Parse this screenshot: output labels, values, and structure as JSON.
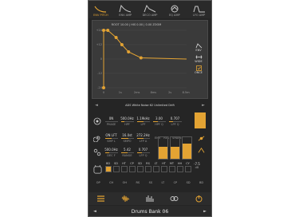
{
  "theme": {
    "accent": "#e3a333",
    "panel": "#3a3a3a",
    "bg": "#252525"
  },
  "tabs": [
    {
      "label": "ENV PITCH",
      "icon": "pitch-curve-icon",
      "active": true
    },
    {
      "label": "ENV AMP",
      "icon": "amp-curve-icon",
      "active": false
    },
    {
      "label": "DECO AMP",
      "icon": "deco-curve-icon",
      "active": false
    },
    {
      "label": "EQ AMP",
      "icon": "eq-curve-icon",
      "active": false
    },
    {
      "label": "LFO AMP",
      "icon": "lfo-curve-icon",
      "active": false
    }
  ],
  "envelope": {
    "title": "ROOT 10.00 | HIS 0.00 | 0.00 ZOOM",
    "y_ticks": [
      "+24",
      "+12",
      "0",
      "-12",
      "-24"
    ],
    "x_ticks": [
      "0",
      "1s",
      "2ms",
      "8ms",
      "2s",
      "8.5ms"
    ],
    "points": [
      {
        "t": 0.0,
        "v": 24
      },
      {
        "t": 0.5,
        "v": 24
      },
      {
        "t": 1.5,
        "v": 18
      },
      {
        "t": 2.2,
        "v": 12
      },
      {
        "t": 3.0,
        "v": 6
      },
      {
        "t": 4.5,
        "v": 1
      },
      {
        "t": 10.0,
        "v": 0
      }
    ],
    "side_buttons": [
      {
        "label": "ENV",
        "icon": "env-icon"
      },
      {
        "label": "WIDE",
        "icon": "wide-icon"
      },
      {
        "label": "ONCE",
        "icon": "once-icon"
      }
    ]
  },
  "preset": {
    "name": "ADS White Noise 62 Unlimited Drift",
    "prev": "◄",
    "next": "►"
  },
  "filter_row": {
    "icon": "filter-icon",
    "knobs": [
      {
        "value": "0N",
        "label": "PHASE",
        "level": 0.0
      },
      {
        "value": "500.0Hz",
        "label": "HPF",
        "level": 0.3
      },
      {
        "value": "1.19kHz",
        "label": "LPF",
        "level": 0.5
      },
      {
        "value": "3.00",
        "label": "HPF Q",
        "level": 0.4
      },
      {
        "value": "0.707",
        "label": "LPF Q",
        "level": 0.35
      }
    ],
    "button_label": "ON"
  },
  "mod_row1": {
    "icon": "spiral-icon",
    "knobs": [
      {
        "value": "ON LFT",
        "label": "SMP L",
        "level": 0.5
      },
      {
        "value": "16.0st",
        "label": "SMPO",
        "level": 0.6
      },
      {
        "value": "272.2Hz",
        "label": "LFP A",
        "level": 0.55
      }
    ],
    "meter_labels": [
      "ENV",
      "RES",
      "SHAPE"
    ],
    "meter_levels": [
      0.0,
      0.0,
      0.0
    ]
  },
  "mod_row2": {
    "icon": "drift-icon",
    "knobs": [
      {
        "value": "500.0Hz",
        "label": "DEC F",
        "level": 0.35
      },
      {
        "value": "5.42",
        "label": "RANGE",
        "level": 0.5
      },
      {
        "value": "0.707",
        "label": "LFP Q",
        "level": 0.4
      }
    ],
    "meter_levels": [
      0.55,
      0.55,
      0.7
    ]
  },
  "pads": {
    "icon": "drum-icon",
    "labels": [
      "BD",
      "SD",
      "HT",
      "CP",
      "SD",
      "RS",
      "LT",
      "HT",
      "MT",
      "HH",
      "CY"
    ],
    "selected": 0,
    "level_value": "-7.5",
    "level_label": "dB"
  },
  "mix_row": {
    "labels": [
      "OP",
      "CH",
      "OH",
      "RS",
      "SS",
      "LT",
      "CP",
      "SD",
      "BD"
    ],
    "icons": [
      "waveform-icon",
      "sine-icon"
    ]
  },
  "toolbar": {
    "icons": [
      "menu-icon",
      "waveform-icon",
      "levels-icon",
      "loop-icon",
      "power-icon"
    ]
  },
  "footer": {
    "bank": "Drums Bank 06",
    "prev": "◄",
    "next": "►"
  }
}
